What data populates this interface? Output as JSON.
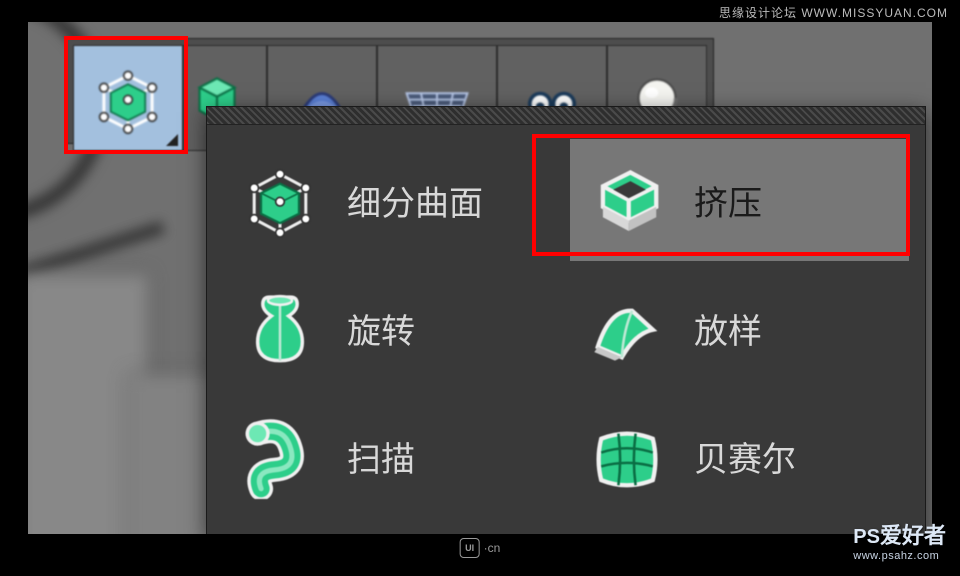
{
  "watermarks": {
    "top_right": "思缘设计论坛  WWW.MISSYUAN.COM",
    "bottom_center_badge": "UI",
    "bottom_center_suffix": "·cn",
    "bottom_right_prefix": "PS",
    "bottom_right_cn": "爱好者",
    "bottom_right_url": "www.psahz.com"
  },
  "menu": {
    "items": [
      {
        "icon": "subdivision-surface",
        "label": "细分曲面"
      },
      {
        "icon": "extrude",
        "label": "挤压"
      },
      {
        "icon": "lathe",
        "label": "旋转"
      },
      {
        "icon": "loft",
        "label": "放样"
      },
      {
        "icon": "sweep",
        "label": "扫描"
      },
      {
        "icon": "bezier",
        "label": "贝赛尔"
      }
    ]
  }
}
